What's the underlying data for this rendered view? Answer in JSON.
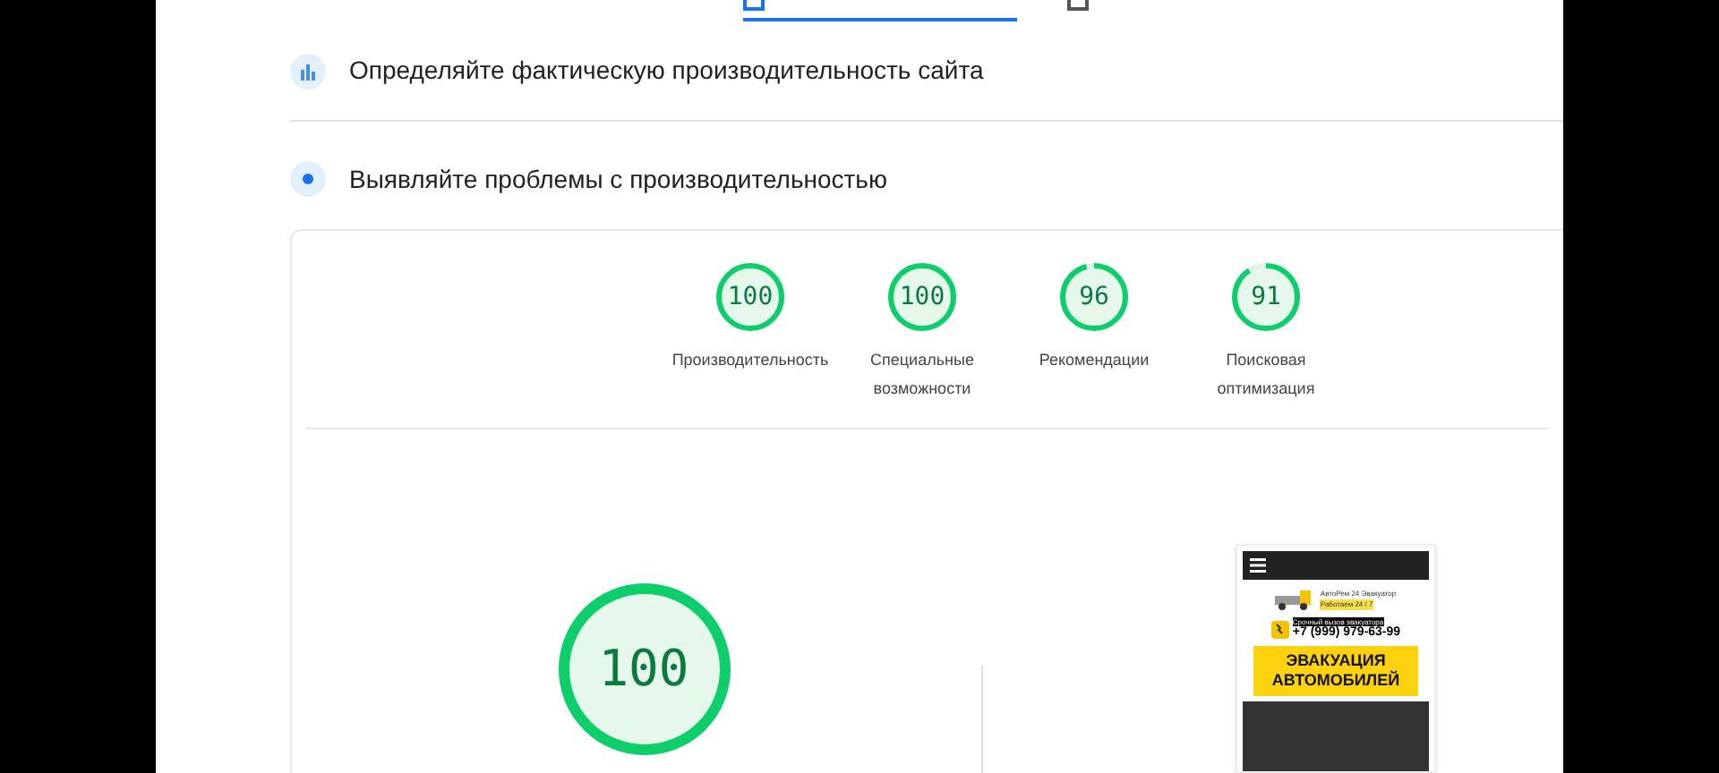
{
  "tabs": [
    {
      "selected": true
    },
    {
      "selected": false
    }
  ],
  "sections": [
    {
      "kind": "field",
      "title": "Определяйте фактическую производительность сайта"
    },
    {
      "kind": "lab",
      "title": "Выявляйте проблемы с производительностью"
    }
  ],
  "scores": [
    {
      "value": "100",
      "label": "Производительность",
      "level": 1
    },
    {
      "value": "100",
      "label": "Специальные возможности",
      "level": 1
    },
    {
      "value": "96",
      "label": "Рекомендации",
      "level": 0.96
    },
    {
      "value": "91",
      "label": "Поисковая оптимизация",
      "level": 0.91
    }
  ],
  "main_score": {
    "value": "100",
    "level": 1
  },
  "preview": {
    "brand": "АвтоРем 24 Эвакуатор",
    "hours": "Работаем 24 / 7",
    "call_label": "Срочный вызов эвакуатора",
    "phone": "+7 (999) 979-63-99",
    "banner": "ЭВАКУАЦИЯ АВТОМОБИЛЕЙ"
  }
}
